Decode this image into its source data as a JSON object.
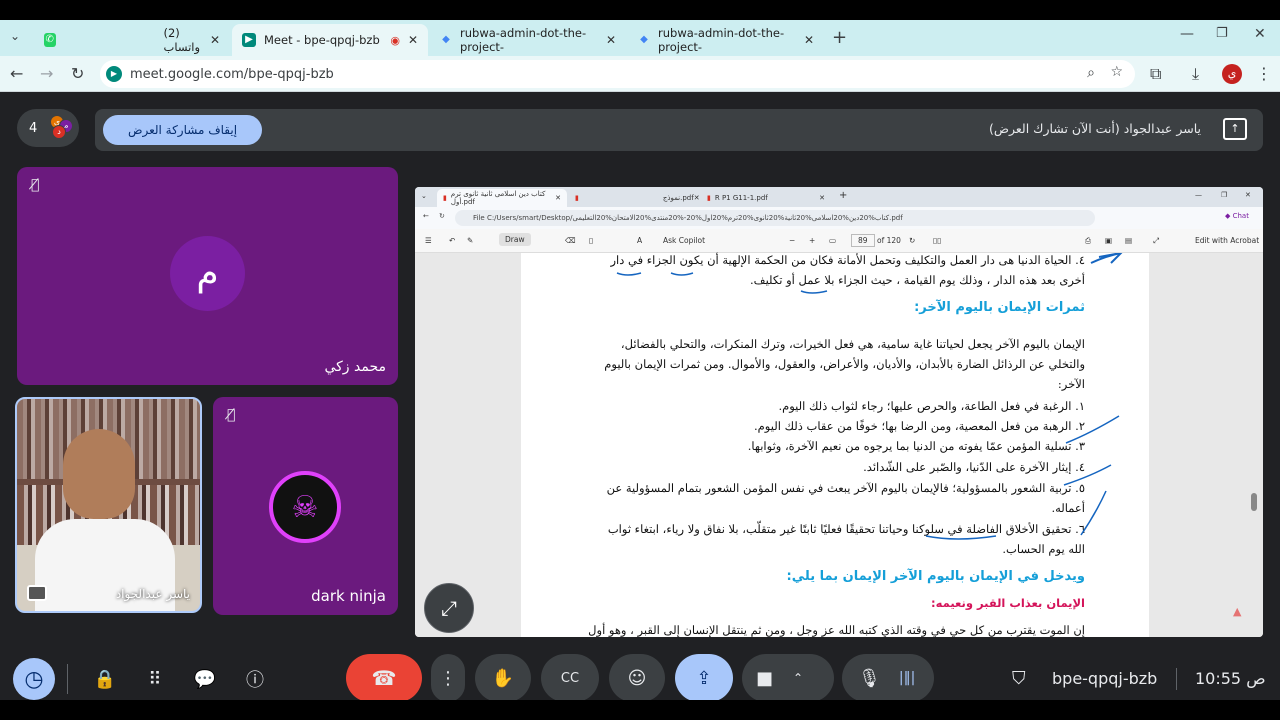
{
  "browser": {
    "tabs": [
      {
        "title": "(2) واتساب",
        "icon": "whatsapp-icon",
        "color": "#25d366"
      },
      {
        "title": "Meet - bpe-qpqj-bzb",
        "icon": "meet-icon",
        "color": "#00897b"
      },
      {
        "title": "rubwa-admin-dot-the-project-",
        "icon": "project-icon",
        "color": "#4285f4"
      },
      {
        "title": "rubwa-admin-dot-the-project-",
        "icon": "project-icon",
        "color": "#4285f4"
      }
    ],
    "url": "meet.google.com/bpe-qpqj-bzb",
    "profile_initial": "ي"
  },
  "meet": {
    "participant_count": "4",
    "stop_sharing_label": "إيقاف مشاركة العرض",
    "presenting_text": "ياسر عبدالجواد (أنت الآن تشارك العرض)",
    "participants": [
      {
        "name": "محمد زكي",
        "initial": "م",
        "muted": true
      },
      {
        "name": "ياسر عبدالجواد",
        "muted": false
      },
      {
        "name": "dark ninja",
        "muted": true
      }
    ],
    "meeting_code": "bpe-qpqj-bzb",
    "time": "10:55",
    "period": "ص",
    "accent": "#a8c7fa",
    "end_call_color": "#ea4335"
  },
  "shared_screen": {
    "tabs": [
      "كتاب دين اسلامى ثانية ثانوى ترم أول.pdf",
      "نموذج.pdf",
      "R P1 G11-1.pdf"
    ],
    "path": "File  C:/Users/smart/Desktop/كتاب%20دين%20اسلامى%20ثانية%20ثانوى%20ترم%20اول%20-%20منتدى%20الامتحان%20التعليمى.pdf",
    "toolbar": {
      "draw": "Draw",
      "copilot": "Ask Copilot",
      "page": "89",
      "total": "of 120",
      "acrobat": "Edit with Acrobat"
    },
    "lines": [
      "٤. الحياة الدنيا هى دار العمل والتكليف وتحمل الأمانة فكان من الحكمة الإلهية أن يكون الجزاء في دار",
      "أخرى بعد هذه الدار ، وذلك يوم القيامة ، حيث الجزاء بلا عمل أو تكليف.",
      "ثمرات الإيمان باليوم الآخر:",
      "الإيمان باليوم الآخر يجعل لحياتنا غاية سامية، هي فعل الخيرات، وترك المنكرات، والتحلي بالفضائل،",
      "والتخلي عن الرذائل الضارة بالأبدان، والأديان، والأعراض، والعقول، والأموال. ومن ثمرات الإيمان باليوم",
      "الآخر:",
      "١. الرغبة في فعل الطاعة، والحرص عليها؛ رجاء لثواب ذلك اليوم.",
      "٢. الرهبة من فعل المعصية، ومن الرضا بها؛ خوفًا من عقاب ذلك اليوم.",
      "٣. تسلية المؤمن عمّا يفوته من الدنيا بما يرجوه من نعيم الآخرة، وثوابها.",
      "٤. إيثار الآخرة على الدّنيا، والصّبر على الشّدائد.",
      "٥. تربية الشعور بالمسؤولية؛ فالإيمان باليوم الآخر يبعث في نفس المؤمن الشعور بتمام المسؤولية عن",
      "أعماله.",
      "٦. تحقيق الأخلاق الفاضلة في سلوكنا وحياتنا تحقيقًا فعليًا ثابتًا غير متقلّب، بلا نفاق ولا رياء، ابتغاء ثواب",
      "الله يوم الحساب.",
      "ويدخل في الإيمان باليوم الآخر الإيمان بما يلي:",
      "الإيمان بعذاب القبر ونعيمه:",
      "إن الموت يقترب من كل حي في وقته الذي كتبه الله عز وجل ، ومن ثم ينتقل الإنسان إلى القبر ، وهو أول"
    ]
  }
}
